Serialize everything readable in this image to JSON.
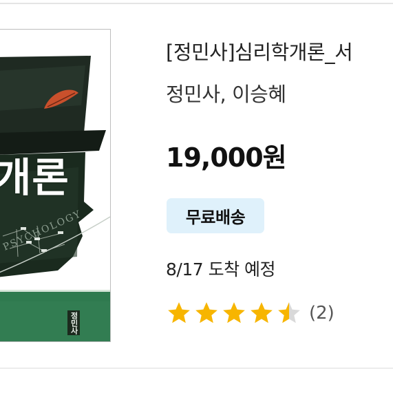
{
  "product": {
    "title": "[정민사]심리학개론_서",
    "author": "정민사, 이승혜",
    "price": "19,000원",
    "badge": "무료배송",
    "delivery": "8/17 도착 예정",
    "rating_value": 4.5,
    "rating_max": 5,
    "review_count": "(2)"
  },
  "cover": {
    "title_text": "개론",
    "subtitle": "PSYCHOLOGY",
    "publisher_mark": "정민사"
  },
  "colors": {
    "star": "#f7b500",
    "star_empty": "#d9d9d9",
    "badge_bg": "#dff1fb",
    "cover_green": "#2f7a4f",
    "cover_dark": "#1b2b1f"
  },
  "icons": {
    "star": "star-icon"
  }
}
